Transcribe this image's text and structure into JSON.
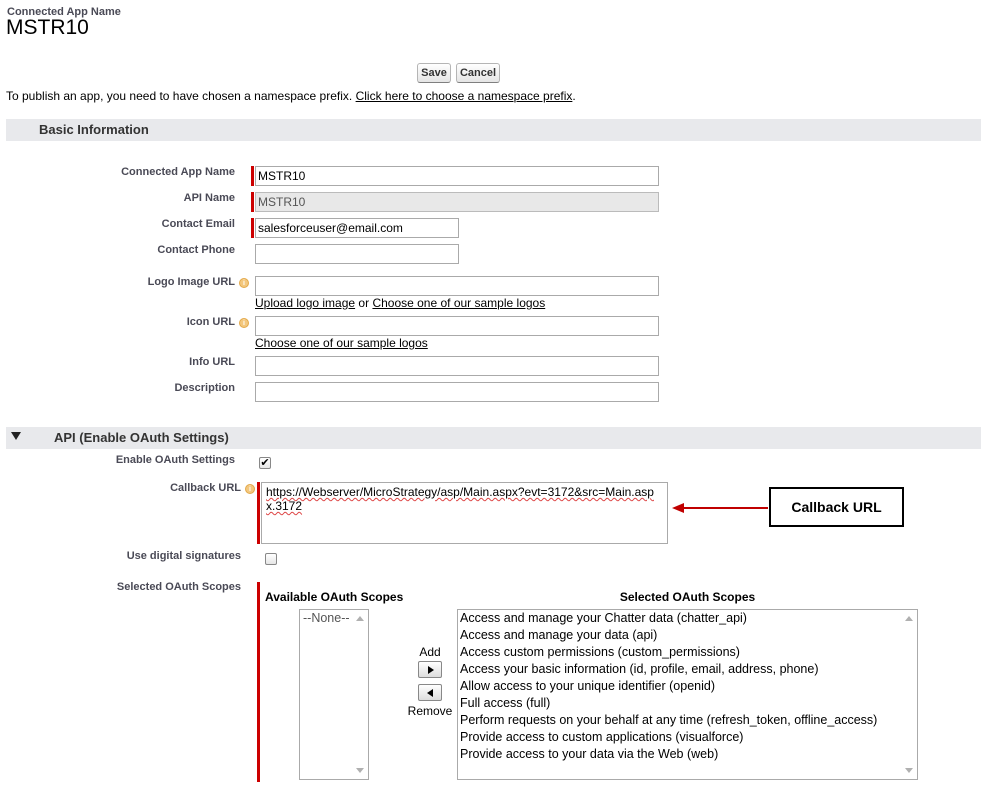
{
  "header": {
    "small_title": "Connected App Name",
    "app_name": "MSTR10"
  },
  "toolbar": {
    "save_label": "Save",
    "cancel_label": "Cancel"
  },
  "namespace_notice": {
    "text": "To publish an app, you need to have chosen a namespace prefix.",
    "link": "Click here to choose a namespace prefix",
    "suffix": "."
  },
  "basic_info": {
    "title": "Basic Information",
    "connected_app_name_label": "Connected App Name",
    "connected_app_name_value": "MSTR10",
    "api_name_label": "API Name",
    "api_name_value": "MSTR10",
    "contact_email_label": "Contact Email",
    "contact_email_value": "salesforceuser@email.com",
    "contact_phone_label": "Contact Phone",
    "contact_phone_value": "",
    "logo_image_url_label": "Logo Image URL",
    "logo_image_url_value": "",
    "upload_logo_link": "Upload logo image",
    "or_text": "or",
    "choose_sample_logos_link": "Choose one of our sample logos",
    "icon_url_label": "Icon URL",
    "icon_url_value": "",
    "icon_choose_sample_link": "Choose one of our sample logos",
    "info_url_label": "Info URL",
    "info_url_value": "",
    "description_label": "Description",
    "description_value": ""
  },
  "api_section": {
    "title": "API (Enable OAuth Settings)",
    "enable_oauth_label": "Enable OAuth Settings",
    "enable_oauth_checked": true,
    "callback_url_label": "Callback URL",
    "callback_url_value": "https://Webserver/MicroStrategy/asp/Main.aspx?evt=3172&src=Main.aspx.3172",
    "use_digital_signatures_label": "Use digital signatures",
    "use_digital_signatures_checked": false,
    "selected_oauth_scopes_label": "Selected OAuth Scopes",
    "available_scopes_header": "Available OAuth Scopes",
    "available_scopes": [
      "--None--"
    ],
    "add_label": "Add",
    "remove_label": "Remove",
    "selected_scopes_header": "Selected OAuth Scopes",
    "selected_scopes": [
      "Access and manage your Chatter data (chatter_api)",
      "Access and manage your data (api)",
      "Access custom permissions (custom_permissions)",
      "Access your basic information (id, profile, email, address, phone)",
      "Allow access to your unique identifier (openid)",
      "Full access (full)",
      "Perform requests on your behalf at any time (refresh_token, offline_access)",
      "Provide access to custom applications (visualforce)",
      "Provide access to your data via the Web (web)"
    ]
  },
  "annotation": {
    "callout_label": "Callback URL",
    "arrow_color": "#c00000"
  },
  "colors": {
    "section_bar": "#e8e9ec",
    "required_bar": "#cc0000",
    "label": "#4a4a56"
  }
}
